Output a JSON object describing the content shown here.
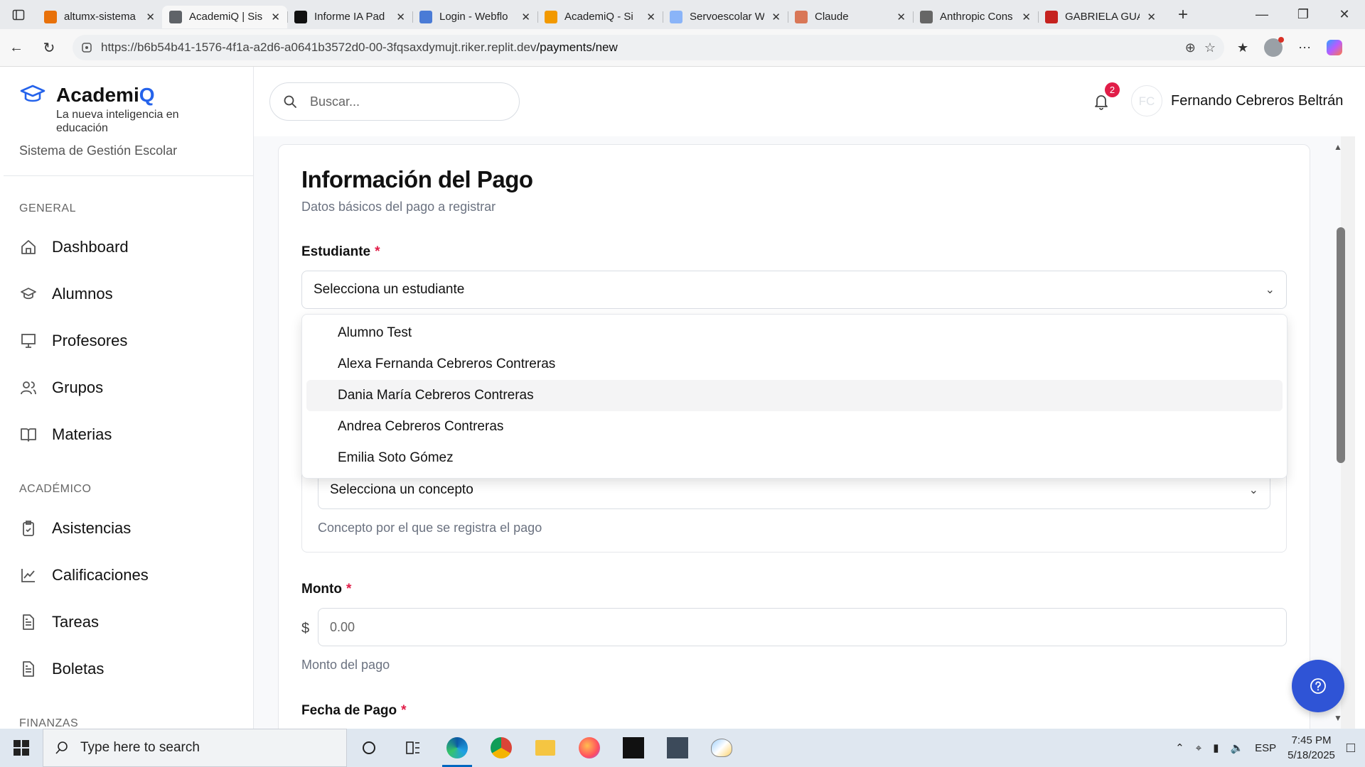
{
  "browser": {
    "tabs": [
      {
        "label": "altumx-sistema",
        "fav_color": "#e8710a",
        "active": false
      },
      {
        "label": "AcademiQ | Sis",
        "fav_color": "#5f6368",
        "active": true
      },
      {
        "label": "Informe IA Pad",
        "fav_color": "#111111",
        "active": false
      },
      {
        "label": "Login - Webflo",
        "fav_color": "#4a7bd6",
        "active": false
      },
      {
        "label": "AcademiQ - Si",
        "fav_color": "#f29900",
        "active": false
      },
      {
        "label": "Servoescolar W",
        "fav_color": "#8ab4f8",
        "active": false
      },
      {
        "label": "Claude",
        "fav_color": "#d97757",
        "active": false
      },
      {
        "label": "Anthropic Cons",
        "fav_color": "#666666",
        "active": false
      },
      {
        "label": "GABRIELA GUA",
        "fav_color": "#c5221f",
        "active": false
      }
    ],
    "url_prefix": "https://b6b54b41-1576-4f1a-a2d6-a0641b3572d0-00-3fqsaxdymujt.riker.replit.dev",
    "url_path": "/payments/new"
  },
  "sidebar": {
    "brand_name_a": "Academi",
    "brand_name_b": "Q",
    "brand_tagline": "La nueva inteligencia en educación",
    "brand_subtitle": "Sistema de Gestión Escolar",
    "section_general": "GENERAL",
    "general_items": [
      {
        "label": "Dashboard",
        "icon": "home-icon"
      },
      {
        "label": "Alumnos",
        "icon": "graduation-cap-icon"
      },
      {
        "label": "Profesores",
        "icon": "presentation-icon"
      },
      {
        "label": "Grupos",
        "icon": "users-icon"
      },
      {
        "label": "Materias",
        "icon": "book-icon"
      }
    ],
    "section_academic": "ACADÉMICO",
    "academic_items": [
      {
        "label": "Asistencias",
        "icon": "clipboard-check-icon"
      },
      {
        "label": "Calificaciones",
        "icon": "chart-line-icon"
      },
      {
        "label": "Tareas",
        "icon": "file-text-icon"
      },
      {
        "label": "Boletas",
        "icon": "file-text-icon"
      }
    ],
    "section_finance": "FINANZAS"
  },
  "header": {
    "search_placeholder": "Buscar...",
    "notification_count": "2",
    "user_initials": "FC",
    "user_name": "Fernando Cebreros Beltrán"
  },
  "form": {
    "title": "Información del Pago",
    "subtitle": "Datos básicos del pago a registrar",
    "student_label": "Estudiante",
    "required_mark": "*",
    "student_placeholder": "Selecciona un estudiante",
    "student_options": [
      "Alumno Test",
      "Alexa Fernanda Cebreros Contreras",
      "Dania María Cebreros Contreras",
      "Andrea Cebreros Contreras",
      "Emilia Soto Gómez"
    ],
    "highlighted_option_index": 2,
    "concept_placeholder": "Selecciona un concepto",
    "concept_hint": "Concepto por el que se registra el pago",
    "amount_label": "Monto",
    "currency_symbol": "$",
    "amount_placeholder": "0.00",
    "amount_hint": "Monto del pago",
    "date_label": "Fecha de Pago"
  },
  "taskbar": {
    "search_placeholder": "Type here to search",
    "language": "ESP",
    "time": "7:45 PM",
    "date": "5/18/2025"
  },
  "colors": {
    "brand_blue": "#2563eb",
    "help_button": "#2f54d6",
    "required_red": "#e11d48"
  }
}
